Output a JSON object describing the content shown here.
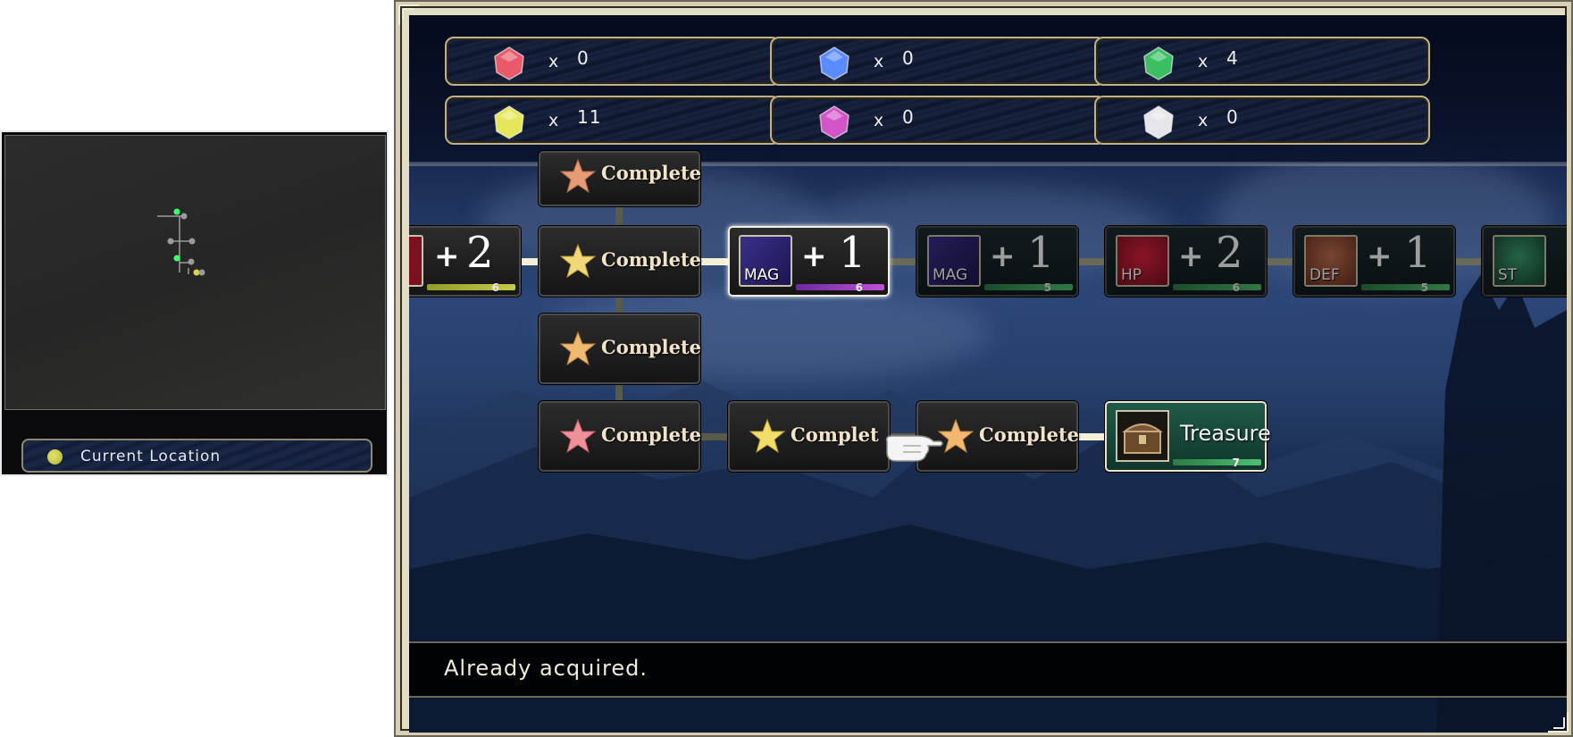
{
  "minimap": {
    "legend_label": "Current Location",
    "location_color": "#d6d64a",
    "visited_color": "#3dff6c",
    "node_color": "#9a9a9a"
  },
  "resources": [
    {
      "gem": "red-gem-icon",
      "color": "#e85a6a",
      "x": "x",
      "count": "0"
    },
    {
      "gem": "blue-gem-icon",
      "color": "#5b8cff",
      "x": "x",
      "count": "0"
    },
    {
      "gem": "green-gem-icon",
      "color": "#3bbf62",
      "x": "x",
      "count": "4"
    },
    {
      "gem": "yellow-gem-icon",
      "color": "#e6e65a",
      "x": "x",
      "count": "11"
    },
    {
      "gem": "purple-gem-icon",
      "color": "#d255c8",
      "x": "x",
      "count": "0"
    },
    {
      "gem": "white-gem-icon",
      "color": "#e6e6ea",
      "x": "x",
      "count": "0"
    }
  ],
  "board": {
    "complete_label": "Complete",
    "partial_label": "Complet",
    "stat_nodes": [
      {
        "id": "hp-partial",
        "icon": "heart-icon",
        "icon_text": "",
        "plus": "+",
        "value": "2",
        "small": "6",
        "bar": "#8f9e2a"
      },
      {
        "id": "mag-selected",
        "icon": "spellbook-icon",
        "icon_text": "MAG",
        "plus": "+",
        "value": "1",
        "small": "6",
        "bar": "#a33fc7"
      },
      {
        "id": "mag-locked",
        "icon": "spellbook-icon",
        "icon_text": "MAG",
        "plus": "+",
        "value": "1",
        "small": "5",
        "bar": "#3fa05a"
      },
      {
        "id": "hp-locked",
        "icon": "heart-icon",
        "icon_text": "HP",
        "plus": "+",
        "value": "2",
        "small": "6",
        "bar": "#3fa05a"
      },
      {
        "id": "def-locked",
        "icon": "shield-icon",
        "icon_text": "DEF",
        "plus": "+",
        "value": "1",
        "small": "5",
        "bar": "#3fa05a"
      },
      {
        "id": "st-locked",
        "icon": "gem-icon",
        "icon_text": "ST",
        "plus": "",
        "value": "",
        "small": "",
        "bar": "#3fa05a"
      }
    ],
    "treasure": {
      "label": "Treasure",
      "small": "7"
    }
  },
  "message": "Already acquired."
}
